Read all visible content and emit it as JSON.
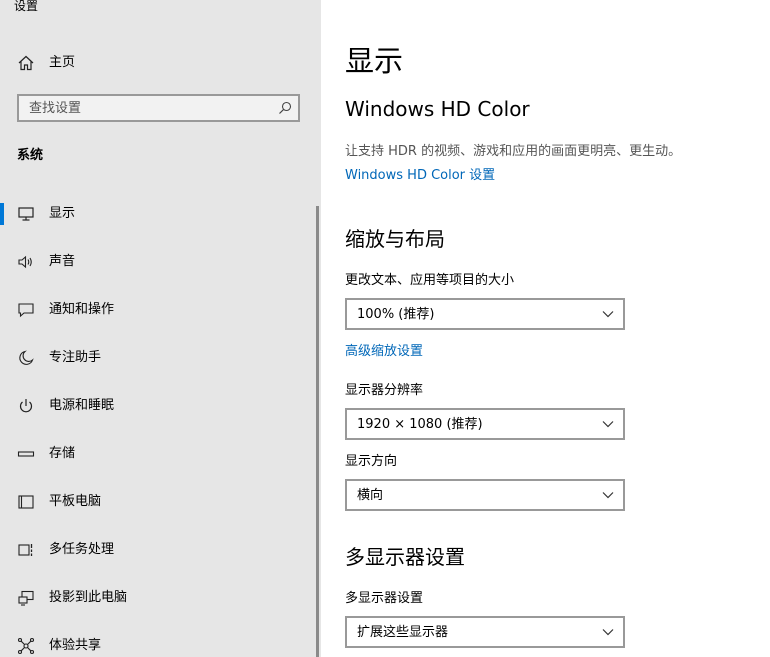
{
  "window": {
    "title": "设置"
  },
  "sidebar": {
    "home_label": "主页",
    "search": {
      "placeholder": "查找设置"
    },
    "section_title": "系统",
    "items": [
      {
        "label": "显示",
        "icon": "monitor-icon",
        "active": true
      },
      {
        "label": "声音",
        "icon": "speaker-icon",
        "active": false
      },
      {
        "label": "通知和操作",
        "icon": "notification-icon",
        "active": false
      },
      {
        "label": "专注助手",
        "icon": "moon-icon",
        "active": false
      },
      {
        "label": "电源和睡眠",
        "icon": "power-icon",
        "active": false
      },
      {
        "label": "存储",
        "icon": "storage-icon",
        "active": false
      },
      {
        "label": "平板电脑",
        "icon": "tablet-icon",
        "active": false
      },
      {
        "label": "多任务处理",
        "icon": "multitasking-icon",
        "active": false
      },
      {
        "label": "投影到此电脑",
        "icon": "project-icon",
        "active": false
      },
      {
        "label": "体验共享",
        "icon": "share-icon",
        "active": false
      }
    ]
  },
  "main": {
    "page_title": "显示",
    "hd_color": {
      "title": "Windows HD Color",
      "description": "让支持 HDR 的视频、游戏和应用的画面更明亮、更生动。",
      "link": "Windows HD Color 设置"
    },
    "scale_layout": {
      "title": "缩放与布局",
      "scale_label": "更改文本、应用等项目的大小",
      "scale_value": "100% (推荐)",
      "advanced_link": "高级缩放设置",
      "resolution_label": "显示器分辨率",
      "resolution_value": "1920 × 1080 (推荐)",
      "orientation_label": "显示方向",
      "orientation_value": "横向"
    },
    "multi_display": {
      "title": "多显示器设置",
      "label": "多显示器设置",
      "value": "扩展这些显示器"
    }
  },
  "colors": {
    "accent": "#0078d7",
    "link": "#0067b8",
    "sidebar_bg": "#e6e6e6"
  }
}
